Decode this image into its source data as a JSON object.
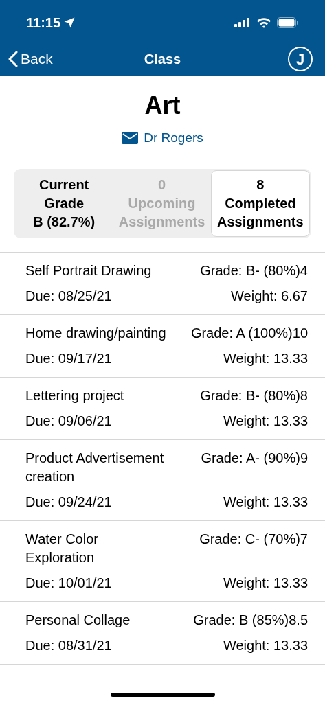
{
  "status_bar": {
    "time": "11:15"
  },
  "nav": {
    "back": "Back",
    "title": "Class",
    "avatar": "J"
  },
  "class": {
    "name": "Art",
    "teacher": "Dr Rogers"
  },
  "segments": [
    {
      "lines": [
        "Current",
        "Grade",
        "B (82.7%)"
      ],
      "selected": false,
      "disabled": false
    },
    {
      "lines": [
        "0",
        "Upcoming",
        "Assignments"
      ],
      "selected": false,
      "disabled": true
    },
    {
      "lines": [
        "8",
        "Completed",
        "Assignments"
      ],
      "selected": true,
      "disabled": false
    }
  ],
  "assignments": [
    {
      "title": "Self Portrait Drawing",
      "grade": "Grade: B- (80%)4",
      "due": "Due: 08/25/21",
      "weight": "Weight: 6.67"
    },
    {
      "title": "Home drawing/painting",
      "grade": "Grade: A (100%)10",
      "due": "Due: 09/17/21",
      "weight": "Weight: 13.33"
    },
    {
      "title": "Lettering project",
      "grade": "Grade: B- (80%)8",
      "due": "Due: 09/06/21",
      "weight": "Weight: 13.33"
    },
    {
      "title": "Product Advertisement creation",
      "grade": "Grade: A- (90%)9",
      "due": "Due: 09/24/21",
      "weight": "Weight: 13.33"
    },
    {
      "title": "Water Color Exploration",
      "grade": "Grade: C- (70%)7",
      "due": "Due: 10/01/21",
      "weight": "Weight: 13.33"
    },
    {
      "title": "Personal Collage",
      "grade": "Grade: B (85%)8.5",
      "due": "Due: 08/31/21",
      "weight": "Weight: 13.33"
    }
  ]
}
